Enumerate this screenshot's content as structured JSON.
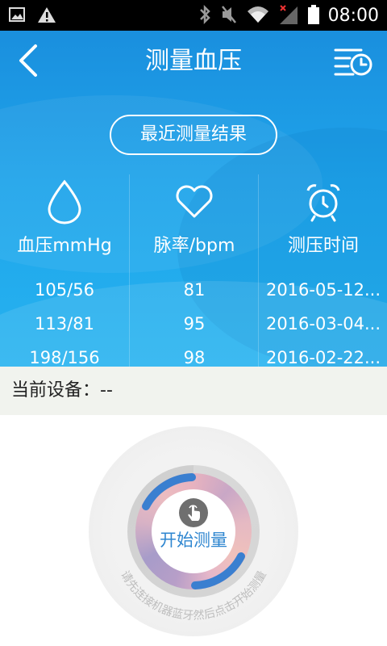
{
  "status_bar": {
    "time": "08:00",
    "icons": [
      "image-icon",
      "warning-icon",
      "bluetooth-icon",
      "mute-icon",
      "wifi-icon",
      "signal-icon",
      "battery-icon"
    ]
  },
  "header": {
    "title": "测量血压",
    "back_icon": "chevron-left-icon",
    "history_icon": "history-list-icon"
  },
  "recent": {
    "button_label": "最近测量结果",
    "columns": [
      {
        "icon": "drop-icon",
        "heading": "血压mmHg",
        "values": [
          "105/56",
          "113/81",
          "198/156"
        ]
      },
      {
        "icon": "heart-icon",
        "heading": "脉率/bpm",
        "values": [
          "81",
          "95",
          "98"
        ]
      },
      {
        "icon": "alarm-clock-icon",
        "heading": "测压时间",
        "values": [
          "2016-05-12...",
          "2016-03-04...",
          "2016-02-22..."
        ]
      }
    ]
  },
  "device": {
    "label": "当前设备：--"
  },
  "dial": {
    "start_label": "开始测量",
    "hint": "请先连接机器蓝牙然后点击开始测量",
    "finger_icon": "finger-tap-icon"
  },
  "colors": {
    "blue_top": "#1a8fde",
    "blue_bottom": "#26b3f0",
    "accent_text": "#2e86d0",
    "arc_blue": "#3a7fd0"
  }
}
